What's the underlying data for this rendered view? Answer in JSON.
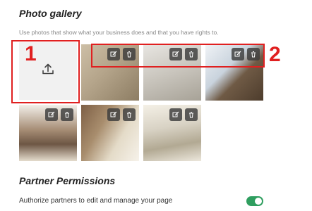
{
  "gallery": {
    "title": "Photo gallery",
    "subtitle": "Use photos that show what your business does and that you have rights to.",
    "annotations": [
      "1",
      "2"
    ]
  },
  "photos": [
    {
      "id": "photo-1",
      "palette": [
        "#b9a98e",
        "#8a7a62",
        "#d8ccb5"
      ]
    },
    {
      "id": "photo-2",
      "palette": [
        "#c9c6c0",
        "#9d998f",
        "#eeeae3"
      ]
    },
    {
      "id": "photo-3",
      "palette": [
        "#cfd7e0",
        "#6b5843",
        "#f2f2f2"
      ]
    },
    {
      "id": "photo-4",
      "palette": [
        "#a58c74",
        "#6d5644",
        "#e9e2d6"
      ]
    },
    {
      "id": "photo-5",
      "palette": [
        "#8e6d50",
        "#d9cbb4",
        "#f5f1e8"
      ]
    },
    {
      "id": "photo-6",
      "palette": [
        "#d8d2c4",
        "#9a927f",
        "#f4f0e6"
      ]
    }
  ],
  "partner": {
    "title": "Partner Permissions",
    "authorize_label": "Authorize partners to edit and manage your page",
    "toggle_on": true
  },
  "colors": {
    "annotation_red": "#e02020",
    "toggle_green": "#2f9e5f"
  }
}
